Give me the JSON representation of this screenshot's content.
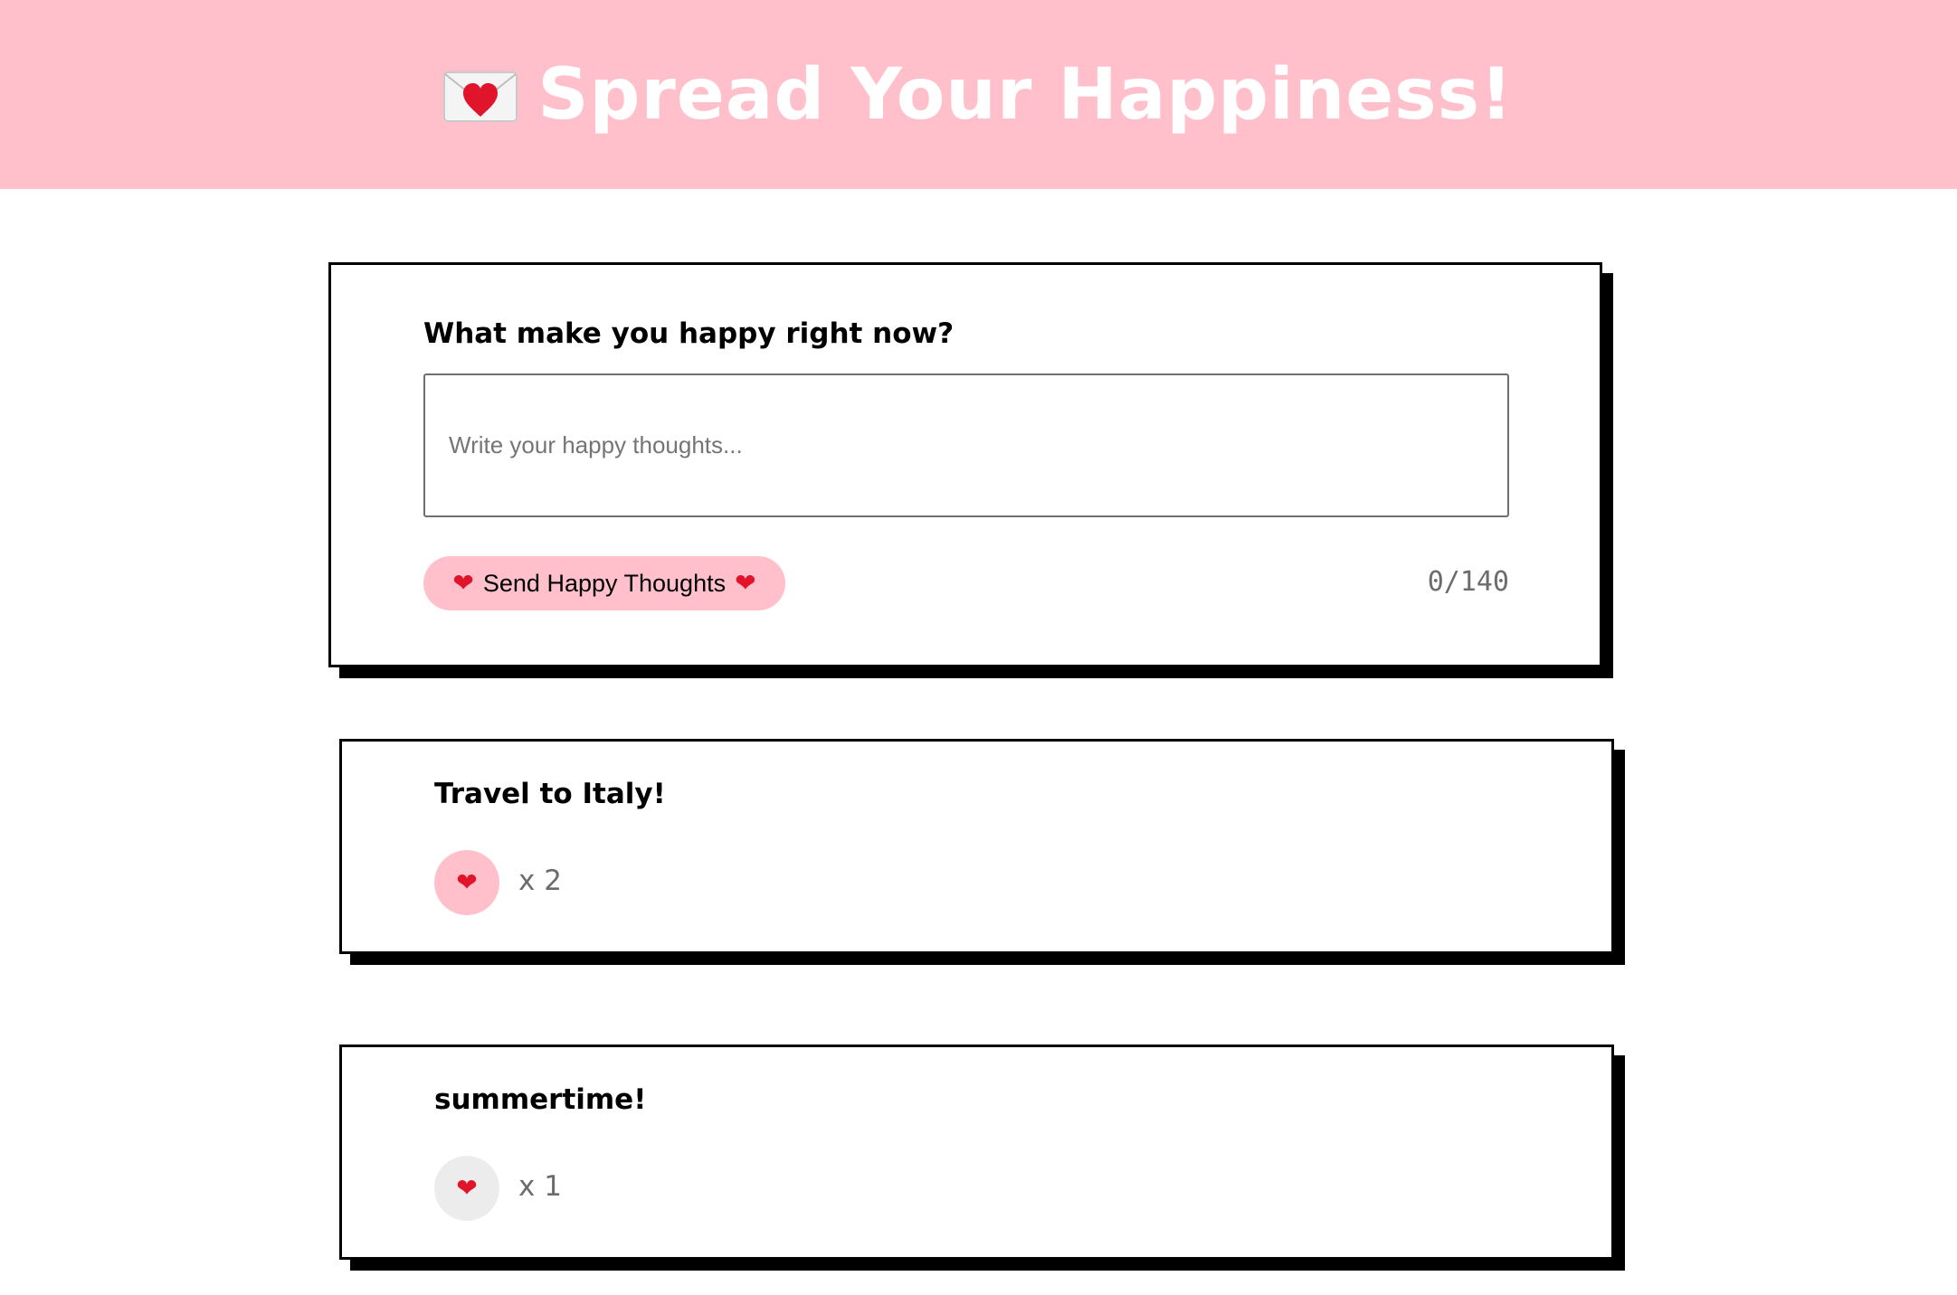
{
  "header": {
    "title": "Spread Your Happiness!",
    "icon": "love-letter-icon",
    "background": "#ffc0cb"
  },
  "form": {
    "question": "What make you happy right now?",
    "placeholder": "Write your happy thoughts...",
    "value": "",
    "send_label": "Send Happy Thoughts",
    "send_icon": "heart-icon",
    "counter": "0/140"
  },
  "thoughts": [
    {
      "text": "Travel to Italy!",
      "likes": "x 2",
      "liked": true
    },
    {
      "text": "summertime!",
      "likes": "x 1",
      "liked": false
    }
  ],
  "colors": {
    "accent": "#ffc0cb",
    "heart": "#e0142a",
    "unliked_button": "#ececec"
  }
}
